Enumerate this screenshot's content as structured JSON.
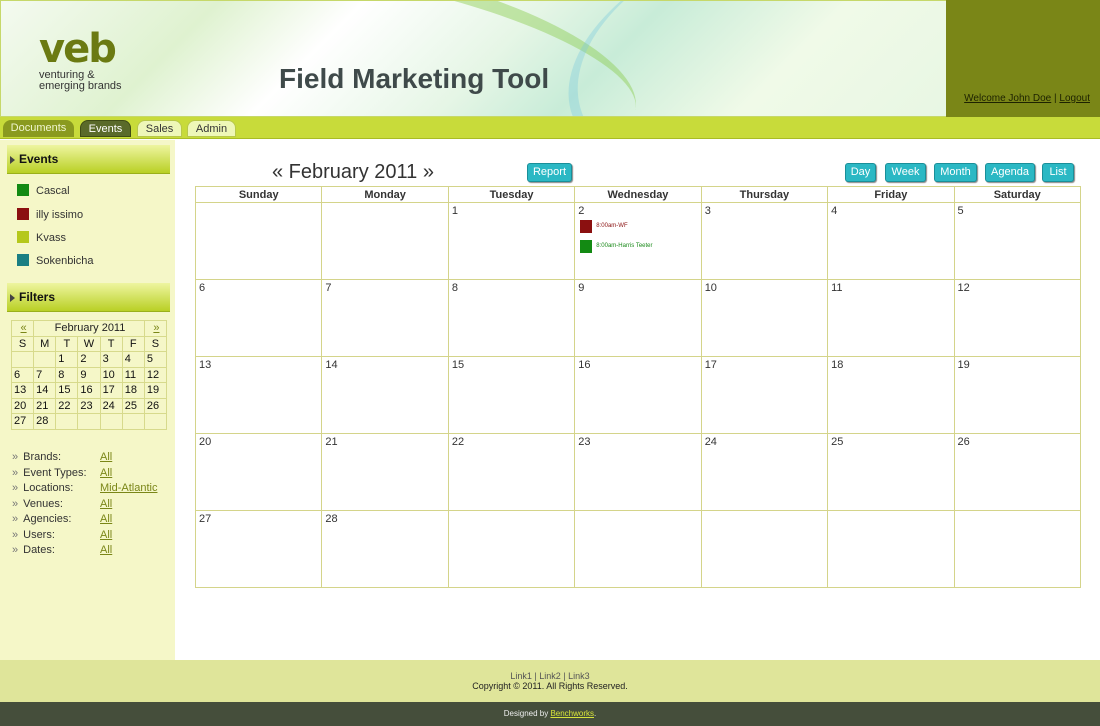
{
  "header": {
    "logo_mark": "veb",
    "logo_sub_line1": "venturing &",
    "logo_sub_line2": "emerging brands",
    "title": "Field Marketing Tool",
    "welcome": "Welcome John Doe",
    "separator": " | ",
    "logout": "Logout"
  },
  "nav": {
    "tabs": [
      {
        "label": "Documents"
      },
      {
        "label": "Events"
      },
      {
        "label": "Sales"
      },
      {
        "label": "Admin"
      }
    ],
    "active": "Events"
  },
  "sidebar": {
    "events_heading": "Events",
    "brands": [
      {
        "label": "Cascal",
        "color": "#138a13"
      },
      {
        "label": "illy issimo",
        "color": "#8b1010"
      },
      {
        "label": "Kvass",
        "color": "#b5c81b"
      },
      {
        "label": "Sokenbicha",
        "color": "#1a7f82"
      }
    ],
    "filters_heading": "Filters",
    "mini_calendar": {
      "prev": "«",
      "next": "»",
      "month": "February 2011",
      "dow": [
        "S",
        "M",
        "T",
        "W",
        "T",
        "F",
        "S"
      ],
      "weeks": [
        [
          "",
          "",
          "1",
          "2",
          "3",
          "4",
          "5"
        ],
        [
          "6",
          "7",
          "8",
          "9",
          "10",
          "11",
          "12"
        ],
        [
          "13",
          "14",
          "15",
          "16",
          "17",
          "18",
          "19"
        ],
        [
          "20",
          "21",
          "22",
          "23",
          "24",
          "25",
          "26"
        ],
        [
          "27",
          "28",
          "",
          "",
          "",
          "",
          ""
        ]
      ]
    },
    "filters": [
      {
        "label": "Brands:",
        "value": "All"
      },
      {
        "label": "Event Types:",
        "value": "All"
      },
      {
        "label": "Locations:",
        "value": "Mid-Atlantic"
      },
      {
        "label": "Venues:",
        "value": "All"
      },
      {
        "label": "Agencies:",
        "value": "All"
      },
      {
        "label": "Users:",
        "value": "All"
      },
      {
        "label": "Dates:",
        "value": "All"
      }
    ]
  },
  "main": {
    "title": "« February 2011 »",
    "report_btn": "Report",
    "view_buttons": [
      "Day",
      "Week",
      "Month",
      "Agenda",
      "List"
    ],
    "calendar": {
      "dow": [
        "Sunday",
        "Monday",
        "Tuesday",
        "Wednesday",
        "Thursday",
        "Friday",
        "Saturday"
      ],
      "weeks": [
        [
          "",
          "",
          "1",
          "2",
          "3",
          "4",
          "5"
        ],
        [
          "6",
          "7",
          "8",
          "9",
          "10",
          "11",
          "12"
        ],
        [
          "13",
          "14",
          "15",
          "16",
          "17",
          "18",
          "19"
        ],
        [
          "20",
          "21",
          "22",
          "23",
          "24",
          "25",
          "26"
        ],
        [
          "27",
          "28",
          "",
          "",
          "",
          "",
          ""
        ]
      ],
      "events": [
        {
          "label": "8:00am-WF",
          "color": "#8b1010"
        },
        {
          "label": "8:00am-Harris Teeter",
          "color": "#138a13"
        }
      ]
    }
  },
  "footer": {
    "links": [
      "Link1",
      "Link2",
      "Link3"
    ],
    "copyright": "Copyright © 2011. All Rights Reserved.",
    "designed_by": "Designed by ",
    "designer": "Benchworks",
    "period": "."
  }
}
